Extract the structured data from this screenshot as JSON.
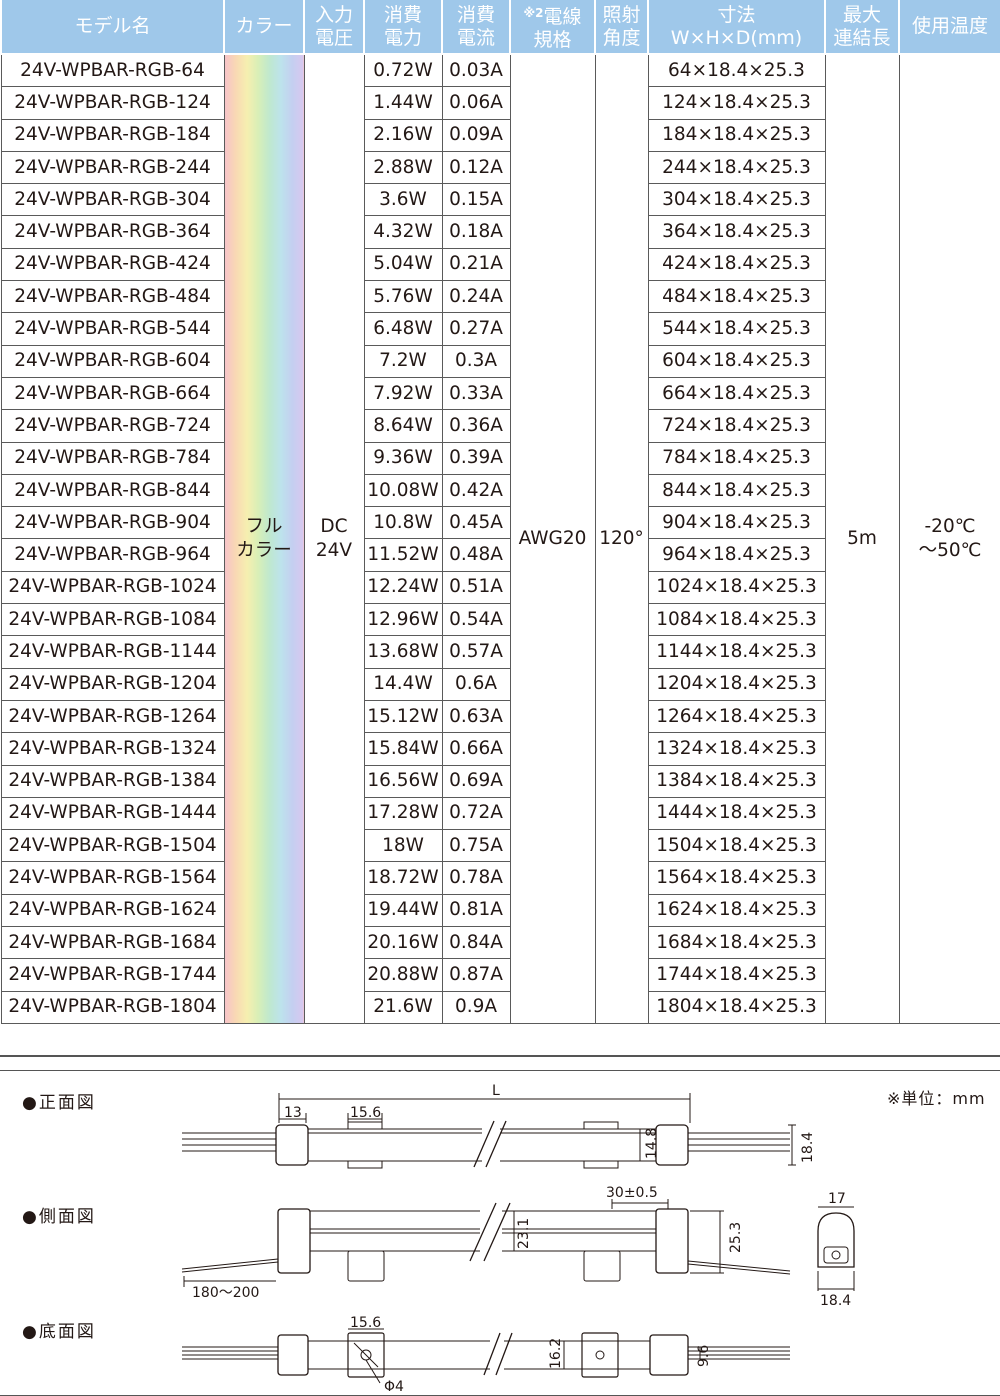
{
  "headers": {
    "model": "モデル名",
    "color": "カラー",
    "voltage": [
      "入力",
      "電圧"
    ],
    "power": [
      "消費",
      "電力"
    ],
    "current": [
      "消費",
      "電流"
    ],
    "wire_mark": "※2",
    "wire": [
      "電線",
      "規格"
    ],
    "angle": [
      "照射",
      "角度"
    ],
    "dims": [
      "寸法",
      "W×H×D(mm)"
    ],
    "maxlen": [
      "最大",
      "連結長"
    ],
    "temp": "使用温度"
  },
  "shared": {
    "color": [
      "フル",
      "カラー"
    ],
    "voltage": [
      "DC",
      "24V"
    ],
    "wire": "AWG20",
    "angle": "120°",
    "maxlen": "5m",
    "temp": [
      "-20℃",
      "～50℃"
    ]
  },
  "rows": [
    {
      "model": "24V-WPBAR-RGB-64",
      "power": "0.72W",
      "current": "0.03A",
      "dims": "64×18.4×25.3"
    },
    {
      "model": "24V-WPBAR-RGB-124",
      "power": "1.44W",
      "current": "0.06A",
      "dims": "124×18.4×25.3"
    },
    {
      "model": "24V-WPBAR-RGB-184",
      "power": "2.16W",
      "current": "0.09A",
      "dims": "184×18.4×25.3"
    },
    {
      "model": "24V-WPBAR-RGB-244",
      "power": "2.88W",
      "current": "0.12A",
      "dims": "244×18.4×25.3"
    },
    {
      "model": "24V-WPBAR-RGB-304",
      "power": "3.6W",
      "current": "0.15A",
      "dims": "304×18.4×25.3"
    },
    {
      "model": "24V-WPBAR-RGB-364",
      "power": "4.32W",
      "current": "0.18A",
      "dims": "364×18.4×25.3"
    },
    {
      "model": "24V-WPBAR-RGB-424",
      "power": "5.04W",
      "current": "0.21A",
      "dims": "424×18.4×25.3"
    },
    {
      "model": "24V-WPBAR-RGB-484",
      "power": "5.76W",
      "current": "0.24A",
      "dims": "484×18.4×25.3"
    },
    {
      "model": "24V-WPBAR-RGB-544",
      "power": "6.48W",
      "current": "0.27A",
      "dims": "544×18.4×25.3"
    },
    {
      "model": "24V-WPBAR-RGB-604",
      "power": "7.2W",
      "current": "0.3A",
      "dims": "604×18.4×25.3"
    },
    {
      "model": "24V-WPBAR-RGB-664",
      "power": "7.92W",
      "current": "0.33A",
      "dims": "664×18.4×25.3"
    },
    {
      "model": "24V-WPBAR-RGB-724",
      "power": "8.64W",
      "current": "0.36A",
      "dims": "724×18.4×25.3"
    },
    {
      "model": "24V-WPBAR-RGB-784",
      "power": "9.36W",
      "current": "0.39A",
      "dims": "784×18.4×25.3"
    },
    {
      "model": "24V-WPBAR-RGB-844",
      "power": "10.08W",
      "current": "0.42A",
      "dims": "844×18.4×25.3"
    },
    {
      "model": "24V-WPBAR-RGB-904",
      "power": "10.8W",
      "current": "0.45A",
      "dims": "904×18.4×25.3"
    },
    {
      "model": "24V-WPBAR-RGB-964",
      "power": "11.52W",
      "current": "0.48A",
      "dims": "964×18.4×25.3"
    },
    {
      "model": "24V-WPBAR-RGB-1024",
      "power": "12.24W",
      "current": "0.51A",
      "dims": "1024×18.4×25.3"
    },
    {
      "model": "24V-WPBAR-RGB-1084",
      "power": "12.96W",
      "current": "0.54A",
      "dims": "1084×18.4×25.3"
    },
    {
      "model": "24V-WPBAR-RGB-1144",
      "power": "13.68W",
      "current": "0.57A",
      "dims": "1144×18.4×25.3"
    },
    {
      "model": "24V-WPBAR-RGB-1204",
      "power": "14.4W",
      "current": "0.6A",
      "dims": "1204×18.4×25.3"
    },
    {
      "model": "24V-WPBAR-RGB-1264",
      "power": "15.12W",
      "current": "0.63A",
      "dims": "1264×18.4×25.3"
    },
    {
      "model": "24V-WPBAR-RGB-1324",
      "power": "15.84W",
      "current": "0.66A",
      "dims": "1324×18.4×25.3"
    },
    {
      "model": "24V-WPBAR-RGB-1384",
      "power": "16.56W",
      "current": "0.69A",
      "dims": "1384×18.4×25.3"
    },
    {
      "model": "24V-WPBAR-RGB-1444",
      "power": "17.28W",
      "current": "0.72A",
      "dims": "1444×18.4×25.3"
    },
    {
      "model": "24V-WPBAR-RGB-1504",
      "power": "18W",
      "current": "0.75A",
      "dims": "1504×18.4×25.3"
    },
    {
      "model": "24V-WPBAR-RGB-1564",
      "power": "18.72W",
      "current": "0.78A",
      "dims": "1564×18.4×25.3"
    },
    {
      "model": "24V-WPBAR-RGB-1624",
      "power": "19.44W",
      "current": "0.81A",
      "dims": "1624×18.4×25.3"
    },
    {
      "model": "24V-WPBAR-RGB-1684",
      "power": "20.16W",
      "current": "0.84A",
      "dims": "1684×18.4×25.3"
    },
    {
      "model": "24V-WPBAR-RGB-1744",
      "power": "20.88W",
      "current": "0.87A",
      "dims": "1744×18.4×25.3"
    },
    {
      "model": "24V-WPBAR-RGB-1804",
      "power": "21.6W",
      "current": "0.9A",
      "dims": "1804×18.4×25.3"
    }
  ],
  "diagrams": {
    "unit_note": "※単位：mm",
    "front": {
      "label": "●正面図",
      "dims": {
        "length": "L",
        "end_cap": "13",
        "clip": "15.6",
        "body_height": "14.8",
        "total_height": "18.4"
      }
    },
    "side": {
      "label": "●側面図",
      "dims": {
        "clip_width": "30±0.5",
        "body_height": "23.1",
        "total_height": "25.3",
        "cable": "180～200",
        "profile_width": "17",
        "profile_depth": "18.4"
      }
    },
    "bottom": {
      "label": "●底面図",
      "dims": {
        "clip": "15.6",
        "body_width": "16.2",
        "wire_width": "9.6",
        "hole": "Φ4"
      }
    }
  },
  "colors": {
    "header_bg": "#9fc8ea",
    "header_text": "#ffffff",
    "border": "#5a5a5a"
  }
}
